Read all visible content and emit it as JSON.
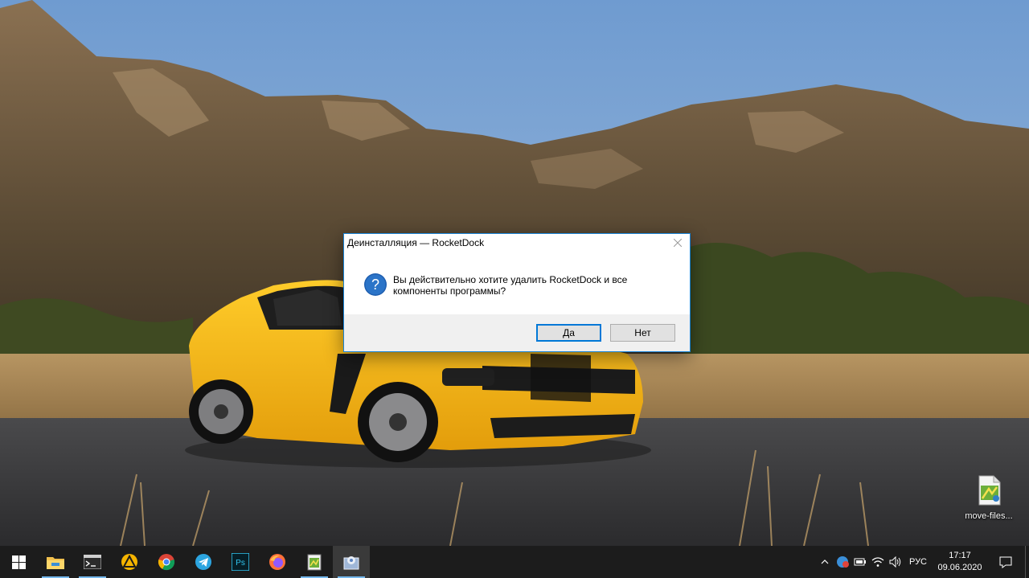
{
  "dialog": {
    "title": "Деинсталляция — RocketDock",
    "message": "Вы действительно хотите удалить RocketDock и все компоненты программы?",
    "yes_label": "Да",
    "no_label": "Нет",
    "icon": "question-icon"
  },
  "desktop": {
    "icon_label": "move-files...",
    "icon": "script-file-icon"
  },
  "taskbar": {
    "apps": [
      {
        "name": "file-explorer-icon"
      },
      {
        "name": "terminal-icon"
      },
      {
        "name": "warning-app-icon"
      },
      {
        "name": "chrome-icon"
      },
      {
        "name": "telegram-icon"
      },
      {
        "name": "photoshop-icon",
        "label": "Ps"
      },
      {
        "name": "firefox-icon"
      },
      {
        "name": "notepad-icon"
      },
      {
        "name": "installer-icon"
      }
    ],
    "language": "РУС",
    "time": "17:17",
    "date": "09.06.2020"
  },
  "colors": {
    "accent": "#0078d7",
    "taskbar": "#1c1c1c",
    "dialog_footer": "#f0f0f0"
  }
}
